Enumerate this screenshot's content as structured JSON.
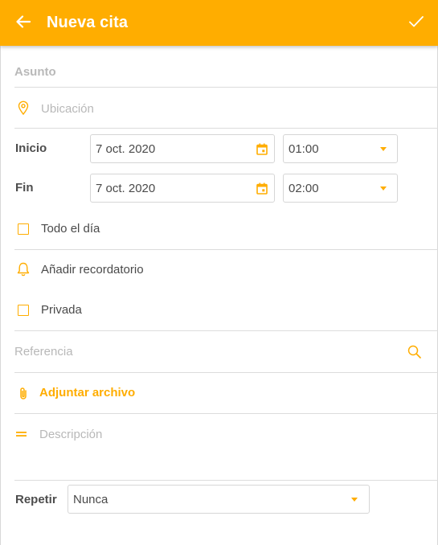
{
  "header": {
    "title": "Nueva cita",
    "back_icon": "arrow-left-icon",
    "confirm_icon": "check-icon"
  },
  "form": {
    "subject_placeholder": "Asunto",
    "location_placeholder": "Ubicación",
    "start": {
      "label": "Inicio",
      "date": "7 oct. 2020",
      "time": "01:00"
    },
    "end": {
      "label": "Fin",
      "date": "7 oct. 2020",
      "time": "02:00"
    },
    "all_day_label": "Todo el día",
    "reminder_label": "Añadir recordatorio",
    "private_label": "Privada",
    "reference_placeholder": "Referencia",
    "attach_label": "Adjuntar archivo",
    "description_placeholder": "Descripción",
    "repeat": {
      "label": "Repetir",
      "value": "Nunca"
    }
  },
  "colors": {
    "accent": "#ffad00",
    "text": "#4a4a4a",
    "placeholder": "#b8b8b8",
    "divider": "#dcdcdc"
  }
}
